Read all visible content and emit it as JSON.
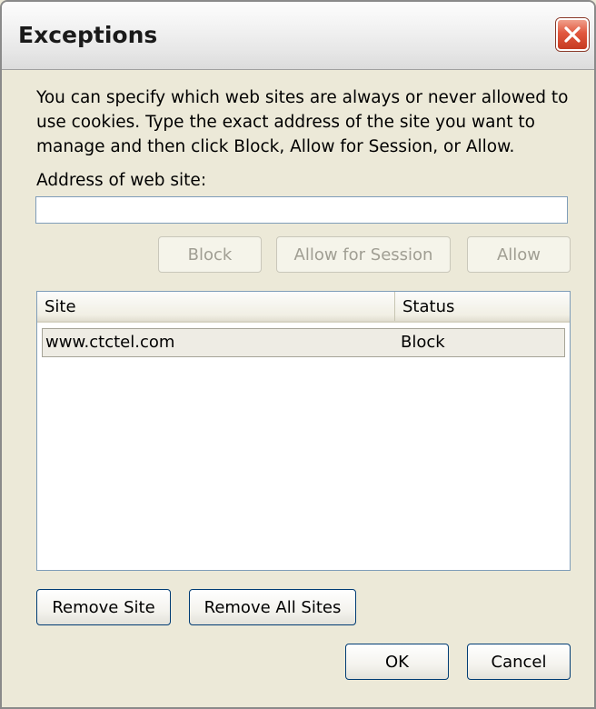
{
  "window": {
    "title": "Exceptions"
  },
  "description": "You can specify which web sites are always or never allowed to use cookies. Type the exact address of the site you want to manage and then click Block, Allow for Session, or Allow.",
  "address": {
    "label": "Address of web site:",
    "value": "",
    "placeholder": ""
  },
  "buttons": {
    "block": "Block",
    "allow_session": "Allow for Session",
    "allow": "Allow",
    "remove_site": "Remove Site",
    "remove_all": "Remove All Sites",
    "ok": "OK",
    "cancel": "Cancel"
  },
  "list": {
    "columns": {
      "site": "Site",
      "status": "Status"
    },
    "rows": [
      {
        "site": "www.ctctel.com",
        "status": "Block"
      }
    ]
  },
  "icons": {
    "close": "close-icon"
  },
  "colors": {
    "close_button": "#e1573e",
    "dialog_bg": "#ece9d8",
    "input_border": "#7f9db9"
  }
}
